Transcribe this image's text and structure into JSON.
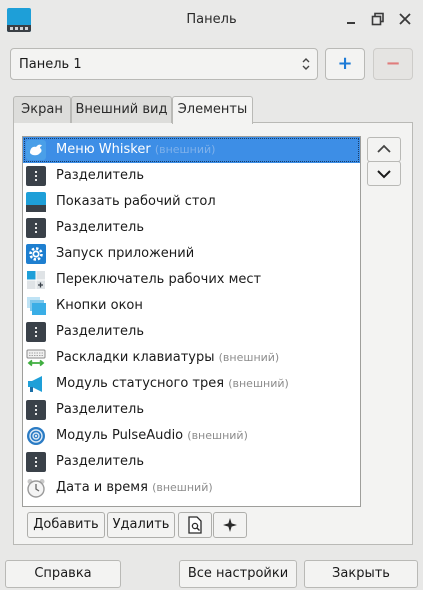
{
  "window": {
    "title": "Панель"
  },
  "panel_selector": {
    "value": "Панель 1",
    "add_label": "+",
    "remove_label": "−"
  },
  "tabs": [
    {
      "label": "Экран"
    },
    {
      "label": "Внешний вид"
    },
    {
      "label": "Элементы",
      "active": true
    }
  ],
  "items": [
    {
      "label": "Меню Whisker",
      "note": "(внешний)",
      "icon": "whisker-menu-icon",
      "selected": true
    },
    {
      "label": "Разделитель",
      "note": "",
      "icon": "separator-icon"
    },
    {
      "label": "Показать рабочий стол",
      "note": "",
      "icon": "show-desktop-icon"
    },
    {
      "label": "Разделитель",
      "note": "",
      "icon": "separator-icon"
    },
    {
      "label": "Запуск приложений",
      "note": "",
      "icon": "launcher-gear-icon"
    },
    {
      "label": "Переключатель рабочих мест",
      "note": "",
      "icon": "workspace-switcher-icon"
    },
    {
      "label": "Кнопки окон",
      "note": "",
      "icon": "window-buttons-icon"
    },
    {
      "label": "Разделитель",
      "note": "",
      "icon": "separator-icon"
    },
    {
      "label": "Раскладки клавиатуры",
      "note": "(внешний)",
      "icon": "keyboard-layout-icon"
    },
    {
      "label": "Модуль статусного трея",
      "note": "(внешний)",
      "icon": "status-tray-megaphone-icon"
    },
    {
      "label": "Разделитель",
      "note": "",
      "icon": "separator-icon"
    },
    {
      "label": "Модуль PulseAudio",
      "note": "(внешний)",
      "icon": "pulseaudio-icon"
    },
    {
      "label": "Разделитель",
      "note": "",
      "icon": "separator-icon"
    },
    {
      "label": "Дата и время",
      "note": "(внешний)",
      "icon": "clock-icon"
    }
  ],
  "item_buttons": {
    "add": "Добавить",
    "remove": "Удалить"
  },
  "footer": {
    "help": "Справка",
    "all_settings": "Все настройки",
    "close": "Закрыть"
  },
  "colors": {
    "accent": "#3d8ee6",
    "brand": "#1e9fd8"
  }
}
